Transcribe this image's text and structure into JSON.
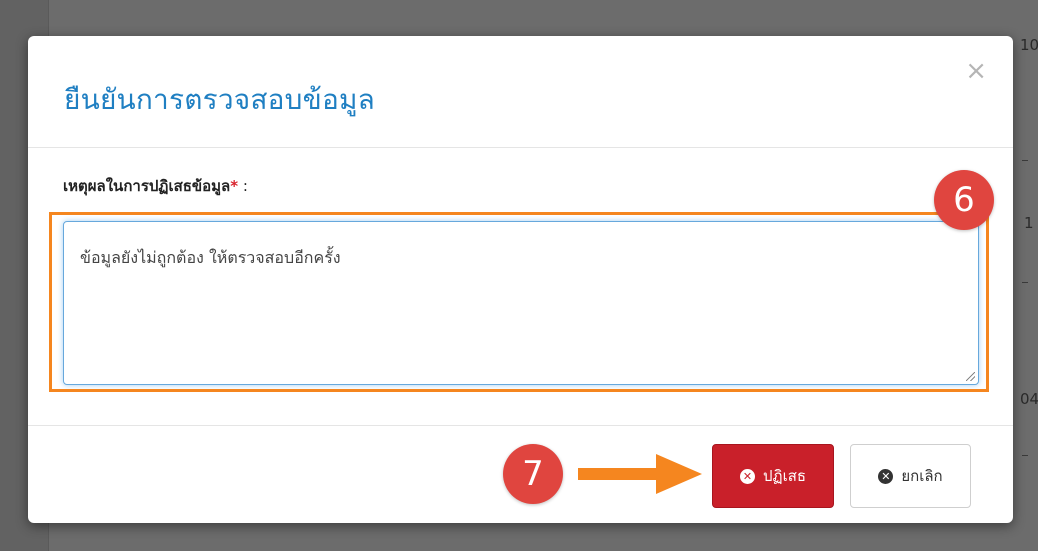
{
  "background": {
    "right_edge_texts": [
      "10",
      "1",
      "04"
    ]
  },
  "modal": {
    "title": "ยืนยันการตรวจสอบข้อมูล",
    "close_symbol": "×",
    "field": {
      "label": "เหตุผลในการปฏิเสธข้อมูล",
      "required_mark": "*",
      "colon": " :",
      "value": "ข้อมูลยังไม่ถูกต้อง ให้ตรวจสอบอีกครั้ง"
    },
    "buttons": {
      "reject_label": "ปฏิเสธ",
      "reject_icon": "times-circle-icon",
      "cancel_label": "ยกเลิก",
      "cancel_icon": "times-circle-icon"
    }
  },
  "annotations": {
    "step_6": "6",
    "step_7": "7"
  },
  "colors": {
    "title": "#1f7fc2",
    "reject_button": "#c9202a",
    "highlight": "#f5861f",
    "badge": "#e0453f",
    "arrow": "#f5861f"
  }
}
